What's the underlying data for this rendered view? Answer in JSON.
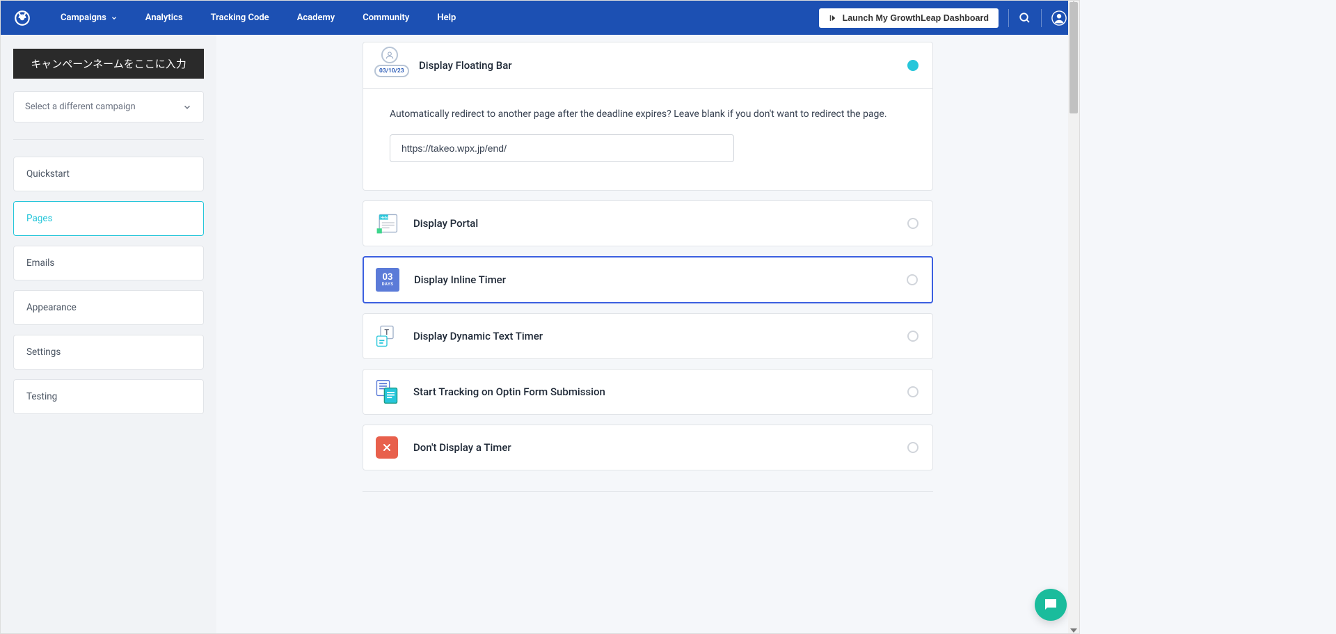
{
  "nav": {
    "campaigns": "Campaigns",
    "analytics": "Analytics",
    "tracking_code": "Tracking Code",
    "academy": "Academy",
    "community": "Community",
    "help": "Help",
    "dashboard_btn": "Launch My GrowthLeap Dashboard"
  },
  "sidebar": {
    "campaign_name": "キャンペーンネームをここに入力",
    "selector_label": "Select a different campaign",
    "items": {
      "quickstart": "Quickstart",
      "pages": "Pages",
      "emails": "Emails",
      "appearance": "Appearance",
      "settings": "Settings",
      "testing": "Testing"
    }
  },
  "main": {
    "floating_bar": {
      "title": "Display Floating Bar",
      "date_badge": "03/10/23",
      "help_text": "Automatically redirect to another page after the deadline expires? Leave blank if you don't want to redirect the page.",
      "url_value": "https://takeo.wpx.jp/end/"
    },
    "portal": {
      "title": "Display Portal",
      "icon_text": "Hello!"
    },
    "inline_timer": {
      "title": "Display Inline Timer",
      "num": "03",
      "label": "DAYS"
    },
    "dynamic_text": {
      "title": "Display Dynamic Text Timer"
    },
    "tracking": {
      "title": "Start Tracking on Optin Form Submission"
    },
    "no_timer": {
      "title": "Don't Display a Timer"
    }
  }
}
